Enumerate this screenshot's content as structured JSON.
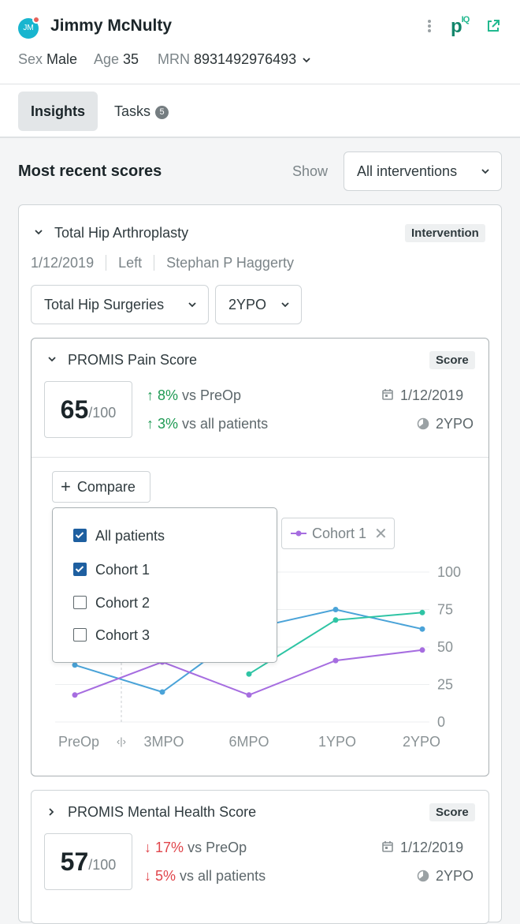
{
  "patient": {
    "initials": "JM",
    "name": "Jimmy McNulty",
    "sex_label": "Sex",
    "sex": "Male",
    "age_label": "Age",
    "age": "35",
    "mrn_label": "MRN",
    "mrn": "8931492976493"
  },
  "brand": {
    "logo_main": "p",
    "logo_sup": "IQ",
    "accent": "#12866b"
  },
  "tabs": [
    {
      "label": "Insights"
    },
    {
      "label": "Tasks",
      "count": "5"
    }
  ],
  "section": {
    "title": "Most recent scores",
    "show_label": "Show",
    "filter_value": "All interventions"
  },
  "intervention": {
    "title": "Total Hip Arthroplasty",
    "tag": "Intervention",
    "date": "1/12/2019",
    "side": "Left",
    "surgeon": "Stephan P Haggerty",
    "cohort_select": "Total Hip Surgeries",
    "timepoint_select": "2YPO"
  },
  "score_cards": [
    {
      "title": "PROMIS Pain Score",
      "tag": "Score",
      "score": "65",
      "denominator": "/100",
      "trend1_value": "8%",
      "trend1_text": "vs PreOp",
      "trend2_value": "3%",
      "trend2_text": "vs all patients",
      "date": "1/12/2019",
      "timepoint": "2YPO"
    },
    {
      "title": "PROMIS Mental Health Score",
      "tag": "Score",
      "score": "57",
      "denominator": "/100",
      "trend1_value": "17%",
      "trend1_text": "vs PreOp",
      "trend2_value": "5%",
      "trend2_text": "vs all patients",
      "date": "1/12/2019",
      "timepoint": "2YPO"
    }
  ],
  "compare": {
    "button_label": "Compare",
    "chip_label": "Cohort 1",
    "options": [
      {
        "label": "All patients",
        "checked": true
      },
      {
        "label": "Cohort 1",
        "checked": true
      },
      {
        "label": "Cohort 2",
        "checked": false
      },
      {
        "label": "Cohort 3",
        "checked": false
      }
    ]
  },
  "chart_data": {
    "type": "line",
    "x": [
      "PreOp",
      "3MPO",
      "6MPO",
      "1YPO",
      "2YPO"
    ],
    "ylim": [
      0,
      100
    ],
    "yticks": [
      0,
      25,
      50,
      75,
      100
    ],
    "grid": true,
    "series": [
      {
        "color": "#4aa3d8",
        "values": [
          38,
          20,
          62,
          75,
          62
        ]
      },
      {
        "color": "#2ec4a4",
        "values": [
          null,
          null,
          32,
          68,
          73
        ]
      },
      {
        "name": "Cohort 1",
        "color": "#a66de0",
        "values": [
          18,
          40,
          18,
          41,
          48
        ]
      }
    ]
  }
}
